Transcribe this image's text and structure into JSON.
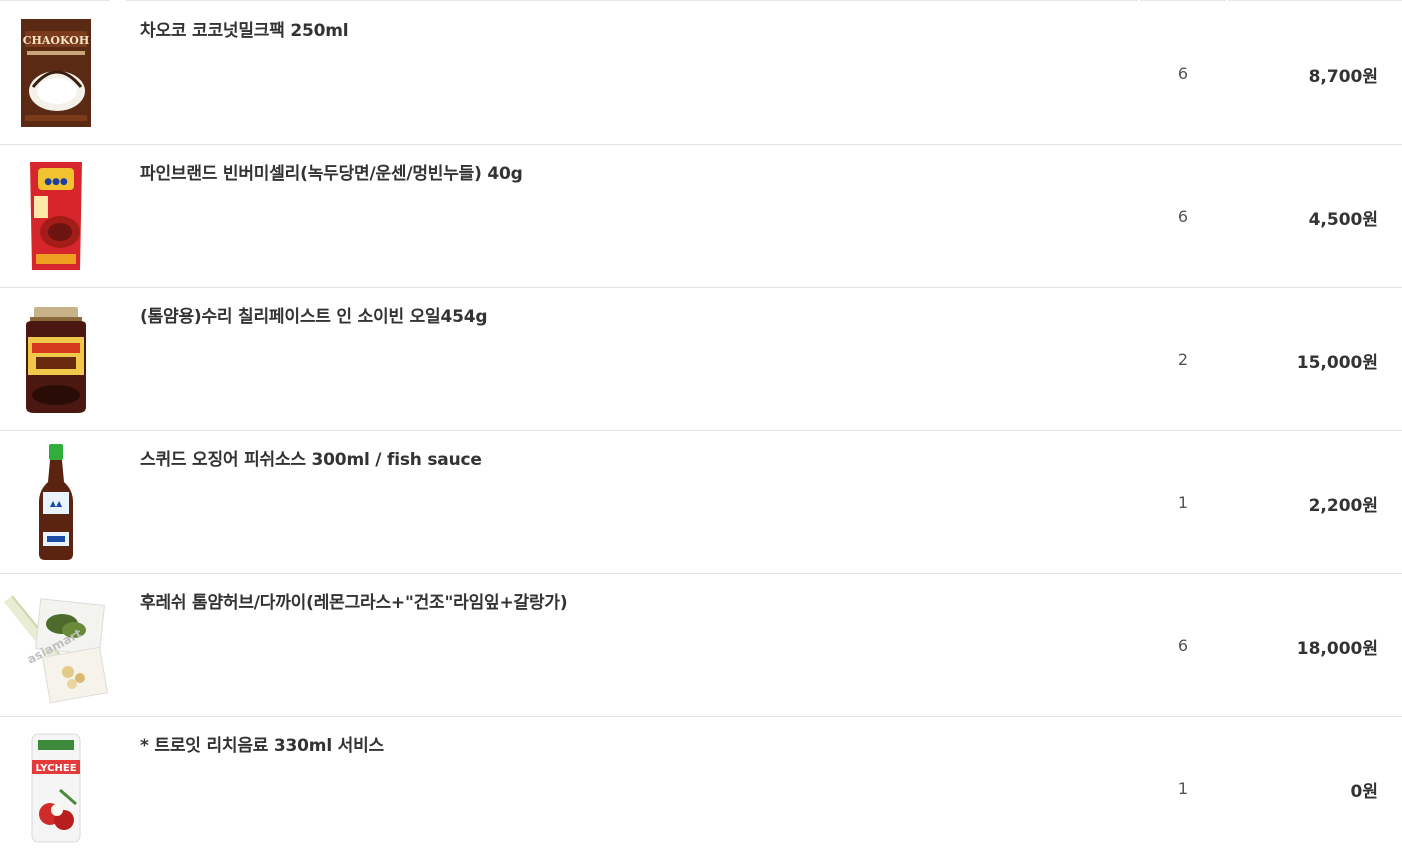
{
  "cart": {
    "items": [
      {
        "name": "차오코 코코넛밀크팩 250ml",
        "qty": "6",
        "price": "8,700원",
        "image": "coconut-milk-carton-image",
        "image_label": "CHAOKOH"
      },
      {
        "name": "파인브랜드 빈버미셀리(녹두당면/운센/멍빈누들) 40g",
        "qty": "6",
        "price": "4,500원",
        "image": "glass-noodle-pack-image"
      },
      {
        "name": "(톰얌용)수리 칠리페이스트 인 소이빈 오일454g",
        "qty": "2",
        "price": "15,000원",
        "image": "chili-paste-jar-image"
      },
      {
        "name": "스퀴드 오징어 피쉬소스 300ml / fish sauce",
        "qty": "1",
        "price": "2,200원",
        "image": "fish-sauce-bottle-image"
      },
      {
        "name": "후레쉬 톰얌허브/다까이(레몬그라스+\"건조\"라임잎+갈랑가)",
        "qty": "6",
        "price": "18,000원",
        "image": "tomyam-herb-pack-image",
        "image_label": "asiamart"
      },
      {
        "name": "* 트로잇 리치음료 330ml 서비스",
        "qty": "1",
        "price": "0원",
        "image": "lychee-drink-can-image",
        "image_label": "LYCHEE"
      }
    ]
  },
  "colors": {
    "divider": "#e4e4e4",
    "text": "#333333",
    "qty_text": "#555555"
  }
}
